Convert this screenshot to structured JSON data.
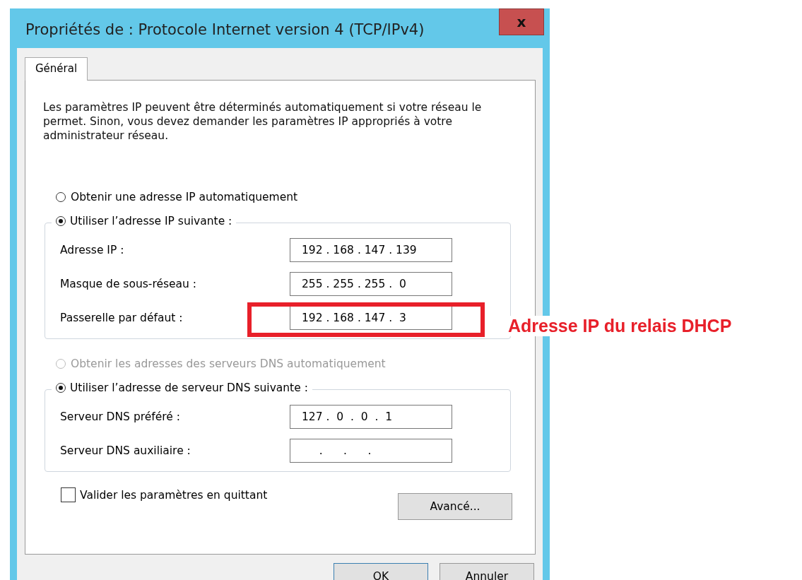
{
  "window": {
    "title": "Propriétés de : Protocole Internet version 4 (TCP/IPv4)",
    "close": "x"
  },
  "tabs": [
    {
      "label": "Général",
      "selected": true
    }
  ],
  "description": "Les paramètres IP peuvent être déterminés automatiquement si votre réseau le permet. Sinon, vous devez demander les paramètres IP appropriés à votre administrateur réseau.",
  "ip_section": {
    "auto_option": {
      "label": "Obtenir une adresse IP automatiquement",
      "selected": false,
      "disabled": false
    },
    "manual_option": {
      "label": "Utiliser l’adresse IP suivante :",
      "selected": true
    },
    "fields": [
      {
        "label": "Adresse IP :",
        "value": "192 . 168 . 147 . 139"
      },
      {
        "label": "Masque de sous-réseau :",
        "value": "255 . 255 . 255 .  0"
      },
      {
        "label": "Passerelle par défaut :",
        "value": "192 . 168 . 147 .  3"
      }
    ]
  },
  "dns_section": {
    "auto_option": {
      "label": "Obtenir les adresses des serveurs DNS automatiquement",
      "selected": false,
      "disabled": true
    },
    "manual_option": {
      "label": "Utiliser l’adresse de serveur DNS suivante :",
      "selected": true
    },
    "fields": [
      {
        "label": "Serveur DNS préféré :",
        "value": "127 .  0  .  0  .  1"
      },
      {
        "label": "Serveur DNS auxiliaire :",
        "value": "     .      .      ."
      }
    ]
  },
  "validate": {
    "label": "Valider les paramètres en quittant",
    "checked": false
  },
  "advanced_button": "Avancé...",
  "buttons": [
    "OK",
    "Annuler"
  ],
  "annotation": {
    "text": "Adresse IP du relais DHCP"
  }
}
